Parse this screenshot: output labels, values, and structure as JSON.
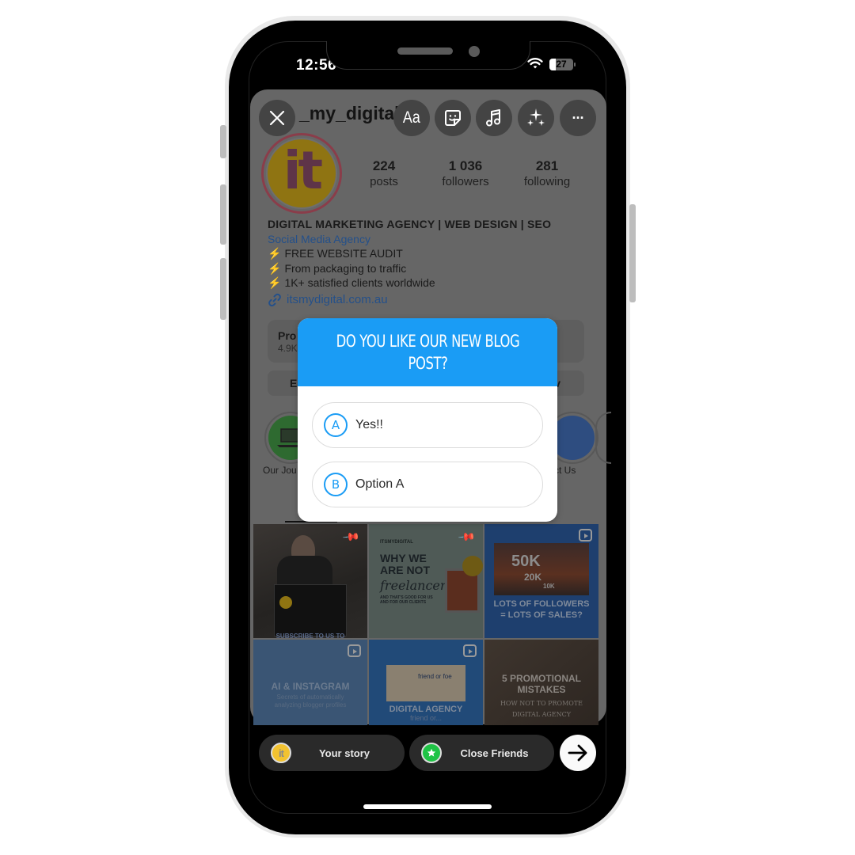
{
  "status_bar": {
    "time": "12:56",
    "signal": "...",
    "battery_percent": 27,
    "battery_label": "27"
  },
  "story_editor": {
    "toolbar": {
      "close_icon": "close-icon",
      "text_label": "Aa",
      "sticker_icon": "sticker-icon",
      "music_icon": "music-note-icon",
      "effects_icon": "sparkles-icon",
      "more_label": "···"
    }
  },
  "profile": {
    "username": "_my_digital",
    "avatar_letters": "it",
    "stats": [
      {
        "value": "224",
        "label": "posts"
      },
      {
        "value": "1 036",
        "label": "followers"
      },
      {
        "value": "281",
        "label": "following"
      }
    ],
    "bio": {
      "title": "DIGITAL MARKETING AGENCY | WEB DESIGN | SEO",
      "category": "Social Media Agency",
      "lines": [
        "FREE WEBSITE AUDIT",
        "From packaging to traffic",
        "1K+ satisfied clients worldwide"
      ],
      "bullet_icon": "⚡",
      "link": "itsmydigital.com.au"
    },
    "dashboard": {
      "title": "Pro",
      "subtitle": "4.9K"
    },
    "actions": {
      "left_partial": "E",
      "right_partial": "v"
    },
    "highlights": [
      {
        "label": "Our Jou",
        "color": "#2e6a30"
      },
      {
        "label": "ct Us",
        "color": "#2e4d80"
      }
    ],
    "grid": [
      {
        "caption": "SUBSCRIBE TO US TO",
        "type": "pinned"
      },
      {
        "caption_brand": "ITSMYDIGITAL",
        "caption_title": "WHY WE ARE NOT",
        "caption_script": "freelancers",
        "caption_sub": "AND THAT'S GOOD FOR US AND FOR OUR CLIENTS",
        "type": "pinned"
      },
      {
        "caption_big": "50K",
        "caption_mid": "20K",
        "caption_small": "10K",
        "caption_title": "LOTS OF FOLLOWERS = LOTS OF SALES?",
        "type": "reel"
      },
      {
        "caption_title": "AI & INSTAGRAM",
        "caption_sub": "Secrets of automatically analyzing blogger profiles",
        "type": "reel"
      },
      {
        "caption_inset": "friend or foe",
        "caption_title": "DIGITAL AGENCY",
        "caption_sub": "friend or...",
        "type": "reel"
      },
      {
        "caption_title": "5 PROMOTIONAL MISTAKES",
        "caption_sub": "HOW NOT TO PROMOTE DIGITAL AGENCY",
        "type": "post"
      }
    ]
  },
  "poll_sticker": {
    "question": "DO YOU LIKE OUR NEW BLOG POST?",
    "question_line1": "DO YOU LIKE OUR NEW BLOG",
    "question_line2": "POST?",
    "accent_color": "#1a9cf5",
    "options": [
      {
        "letter": "A",
        "text": "Yes!!"
      },
      {
        "letter": "B",
        "text": "Option A"
      }
    ]
  },
  "share_bar": {
    "your_story_label": "Your story",
    "close_friends_label": "Close Friends",
    "next_icon": "arrow-right-icon"
  }
}
